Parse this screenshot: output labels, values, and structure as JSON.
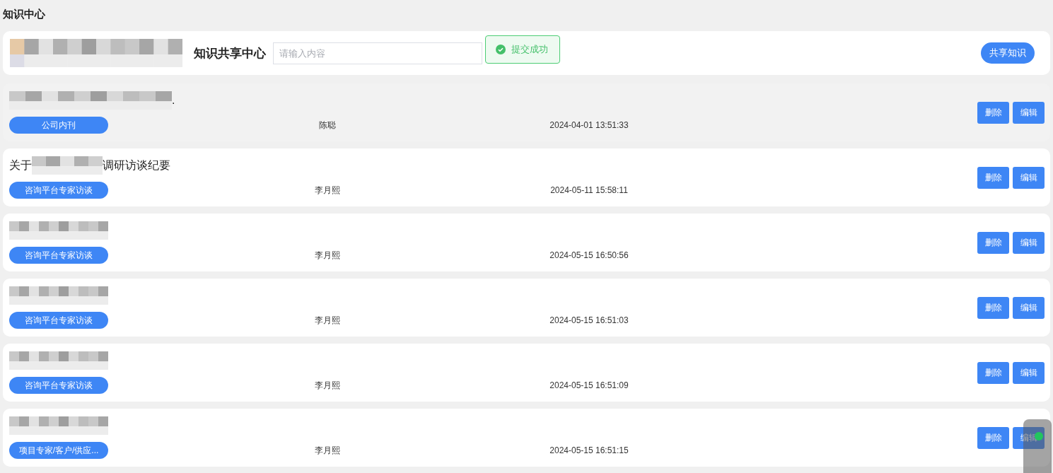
{
  "page_title": "知识中心",
  "header": {
    "title": "知识共享中心",
    "search": {
      "placeholder": "请输入内容"
    },
    "share_button": "共享知识"
  },
  "toast": {
    "message": "提交成功"
  },
  "items": [
    {
      "title_after": ".",
      "highlighted": true,
      "tag": "公司内刊",
      "author": "陈聪",
      "time": "2024-04-01 13:51:33",
      "actions": [
        "删除",
        "编辑"
      ]
    },
    {
      "title_before": "关于",
      "title_after": "调研访谈纪要",
      "highlighted": false,
      "tag": "咨询平台专家访谈",
      "author": "李月熙",
      "time": "2024-05-11 15:58:11",
      "actions": [
        "删除",
        "编辑"
      ]
    },
    {
      "highlighted": false,
      "tag": "咨询平台专家访谈",
      "author": "李月熙",
      "time": "2024-05-15 16:50:56",
      "actions": [
        "删除",
        "编辑"
      ]
    },
    {
      "highlighted": false,
      "tag": "咨询平台专家访谈",
      "author": "李月熙",
      "time": "2024-05-15 16:51:03",
      "actions": [
        "删除",
        "编辑"
      ]
    },
    {
      "highlighted": false,
      "tag": "咨询平台专家访谈",
      "author": "李月熙",
      "time": "2024-05-15 16:51:09",
      "actions": [
        "删除",
        "编辑"
      ]
    },
    {
      "highlighted": false,
      "tag": "项目专家/客户/供应...",
      "author": "李月熙",
      "time": "2024-05-15 16:51:15",
      "actions": [
        "删除",
        "编辑"
      ]
    }
  ]
}
